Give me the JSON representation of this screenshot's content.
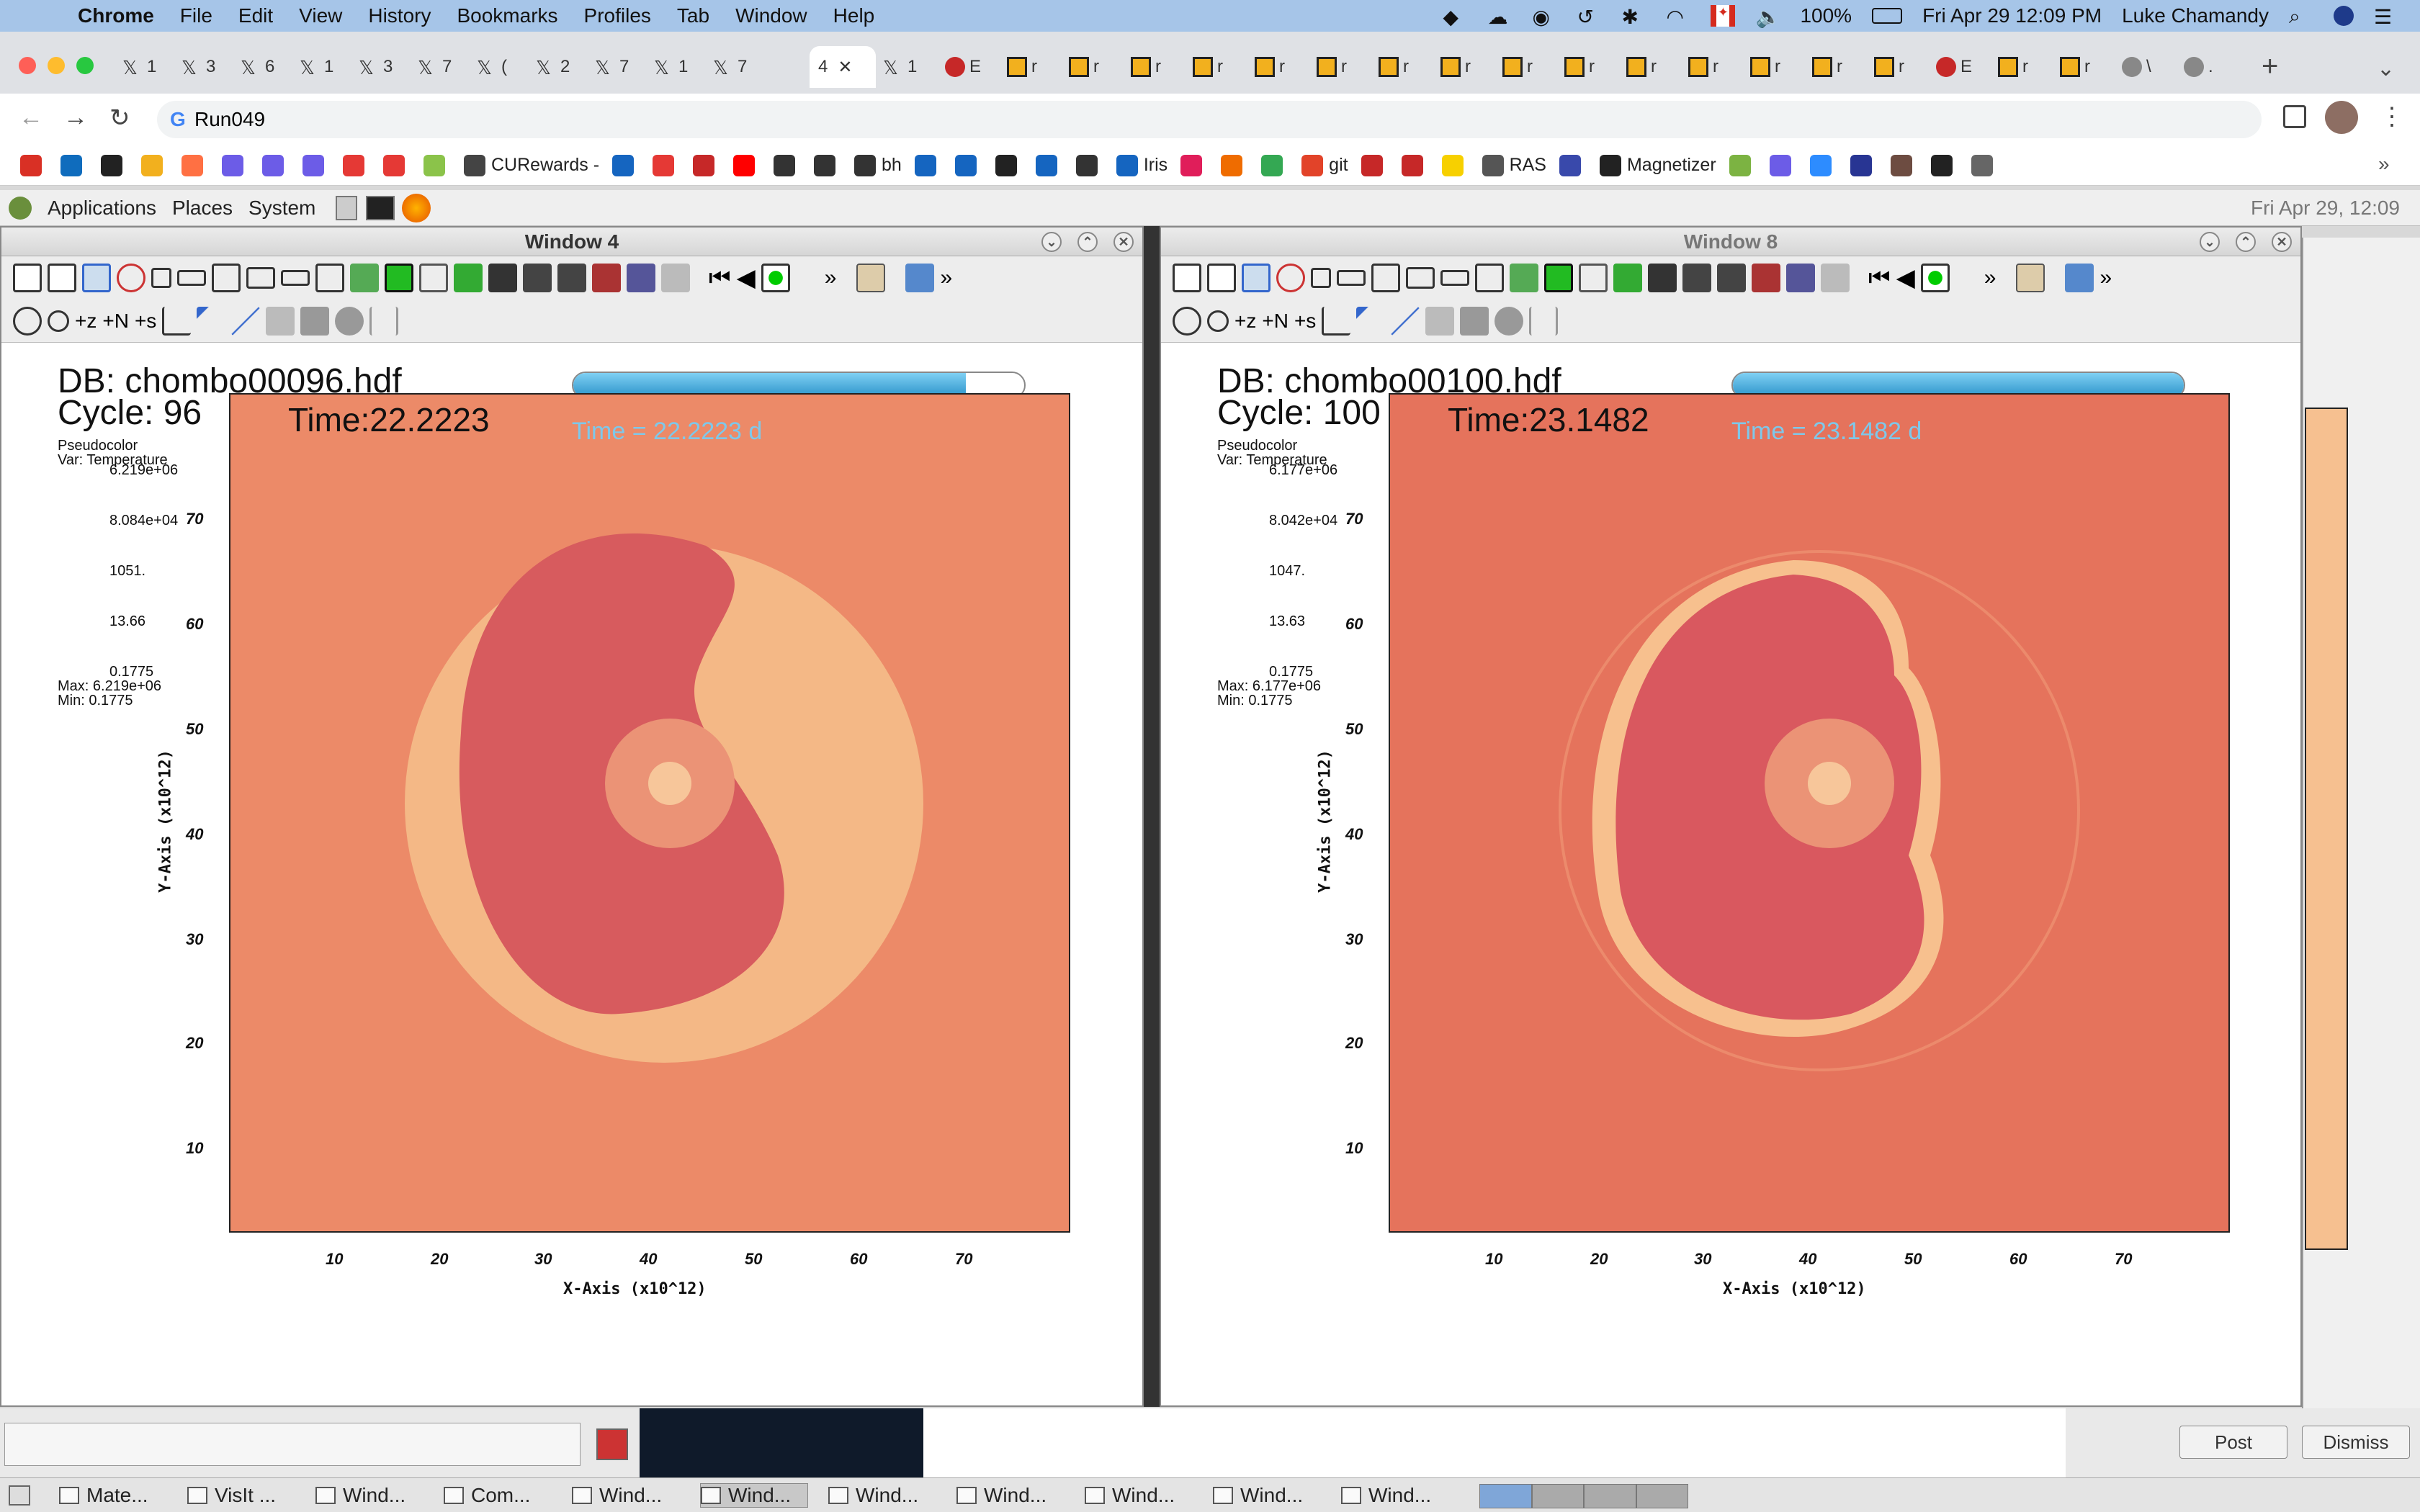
{
  "menubar": {
    "app": "Chrome",
    "items": [
      "File",
      "Edit",
      "View",
      "History",
      "Bookmarks",
      "Profiles",
      "Tab",
      "Window",
      "Help"
    ],
    "battery": "100%",
    "clock": "Fri Apr 29  12:09 PM",
    "user": "Luke Chamandy"
  },
  "browser": {
    "url": "Run049",
    "active_tab_label": "4",
    "tab_short_labels": [
      "1",
      "3",
      "6",
      "1",
      "3",
      "7",
      "(",
      "2",
      "7",
      "1",
      "7",
      "1",
      "E",
      "r",
      "r",
      "r",
      "r",
      "r",
      "r",
      "r",
      "r",
      "r",
      "r",
      "r",
      "r",
      "r",
      "r",
      "r",
      "E",
      "r",
      "r",
      "\\",
      "."
    ]
  },
  "bookmarks": [
    {
      "label": "",
      "color": "#d93025"
    },
    {
      "label": "",
      "color": "#0f6cbd"
    },
    {
      "label": "",
      "color": "#222"
    },
    {
      "label": "",
      "color": "#f2b01e"
    },
    {
      "label": "",
      "color": "#ff7043"
    },
    {
      "label": "",
      "color": "#6c5ce7"
    },
    {
      "label": "",
      "color": "#6c5ce7"
    },
    {
      "label": "",
      "color": "#6c5ce7"
    },
    {
      "label": "",
      "color": "#e53935"
    },
    {
      "label": "",
      "color": "#e53935"
    },
    {
      "label": "",
      "color": "#8bc34a"
    },
    {
      "label": "CURewards -",
      "color": "#444"
    },
    {
      "label": "",
      "color": "#1565c0"
    },
    {
      "label": "",
      "color": "#e53935"
    },
    {
      "label": "",
      "color": "#c62828"
    },
    {
      "label": "",
      "color": "#ff0000"
    },
    {
      "label": "",
      "color": "#333"
    },
    {
      "label": "",
      "color": "#333"
    },
    {
      "label": "bh",
      "color": "#333"
    },
    {
      "label": "",
      "color": "#1565c0"
    },
    {
      "label": "",
      "color": "#1565c0"
    },
    {
      "label": "",
      "color": "#222"
    },
    {
      "label": "",
      "color": "#1565c0"
    },
    {
      "label": "",
      "color": "#333"
    },
    {
      "label": "Iris",
      "color": "#1565c0"
    },
    {
      "label": "",
      "color": "#e01e5a"
    },
    {
      "label": "",
      "color": "#ef6c00"
    },
    {
      "label": "",
      "color": "#34a853"
    },
    {
      "label": "git",
      "color": "#e24329"
    },
    {
      "label": "",
      "color": "#c62828"
    },
    {
      "label": "",
      "color": "#c62828"
    },
    {
      "label": "",
      "color": "#f7d000"
    },
    {
      "label": "RAS",
      "color": "#555"
    },
    {
      "label": "",
      "color": "#3949ab"
    },
    {
      "label": "Magnetizer",
      "color": "#222"
    },
    {
      "label": "",
      "color": "#7cb342"
    },
    {
      "label": "",
      "color": "#6c5ce7"
    },
    {
      "label": "",
      "color": "#2d8cff"
    },
    {
      "label": "",
      "color": "#283593"
    },
    {
      "label": "",
      "color": "#6d4c41"
    },
    {
      "label": "",
      "color": "#222"
    },
    {
      "label": "",
      "color": "#666"
    }
  ],
  "gnome": {
    "menus": [
      "Applications",
      "Places",
      "System"
    ],
    "clock": "Fri Apr 29, 12:09"
  },
  "windows": [
    {
      "title": "Window 4",
      "db": "DB: chombo00096.hdf",
      "cycle": "Cycle: 96",
      "time": "Time:22.2223",
      "time_overlay": "Time = 22.2223 d",
      "time_progress": 0.87,
      "legend": {
        "title": "Pseudocolor",
        "var": "Var: Temperature",
        "ticks": [
          "6.219e+06",
          "8.084e+04",
          "1051.",
          "13.66",
          "0.1775"
        ],
        "max": "Max: 6.219e+06",
        "min": "Min: 0.1775"
      }
    },
    {
      "title": "Window 8",
      "db": "DB: chombo00100.hdf",
      "cycle": "Cycle: 100",
      "time": "Time:23.1482",
      "time_overlay": "Time = 23.1482 d",
      "time_progress": 1.0,
      "legend": {
        "title": "Pseudocolor",
        "var": "Var: Temperature",
        "ticks": [
          "6.177e+06",
          "8.042e+04",
          "1047.",
          "13.63",
          "0.1775"
        ],
        "max": "Max: 6.177e+06",
        "min": "Min: 0.1775"
      }
    }
  ],
  "axes": {
    "xlabel": "X-Axis (x10^12)",
    "ylabel": "Y-Axis (x10^12)",
    "xticks": [
      "10",
      "20",
      "30",
      "40",
      "50",
      "60",
      "70"
    ],
    "yticks": [
      "70",
      "60",
      "50",
      "40",
      "30",
      "20",
      "10"
    ]
  },
  "taskbar": {
    "items": [
      "Mate...",
      "VisIt ...",
      "Wind...",
      "Com...",
      "Wind...",
      "Wind...",
      "Wind...",
      "Wind...",
      "Wind...",
      "Wind...",
      "Wind..."
    ],
    "active_index": 5
  },
  "dialog": {
    "post": "Post",
    "dismiss": "Dismiss"
  }
}
